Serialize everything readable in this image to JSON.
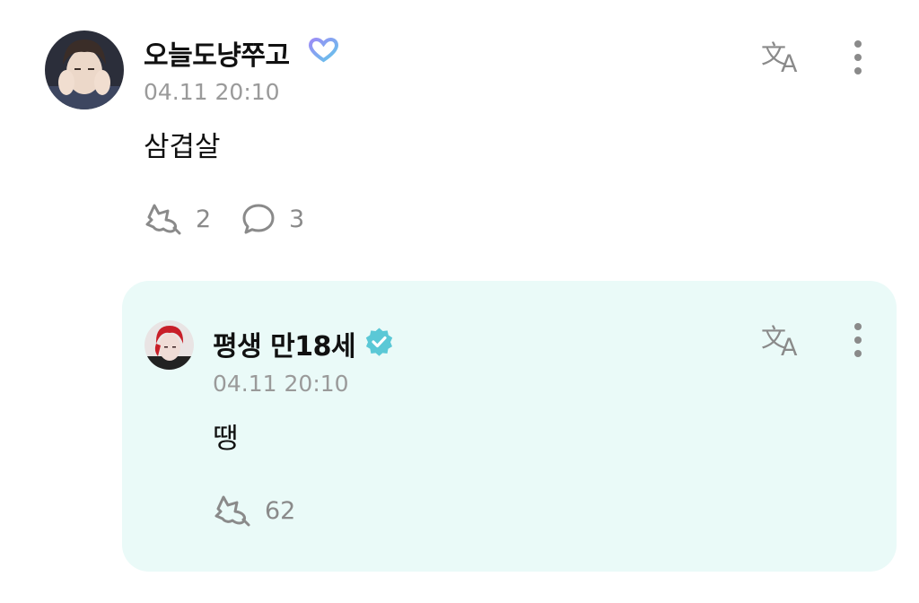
{
  "post": {
    "username": "오늘도냥쭈고",
    "timestamp": "04.11 20:10",
    "text": "삼겹살",
    "like_count": "2",
    "comment_count": "3",
    "badge_icon": "heart-membership-icon",
    "badge_color": "#7c8cf8"
  },
  "reply": {
    "username": "평생 만18세",
    "timestamp": "04.11 20:10",
    "text": "땡",
    "like_count": "62",
    "badge_icon": "verified-check-icon",
    "badge_color": "#5bc8d6"
  },
  "colors": {
    "reply_background": "#eafaf8",
    "secondary_text": "#9a9a9a",
    "icon_gray": "#8a8a8a"
  }
}
